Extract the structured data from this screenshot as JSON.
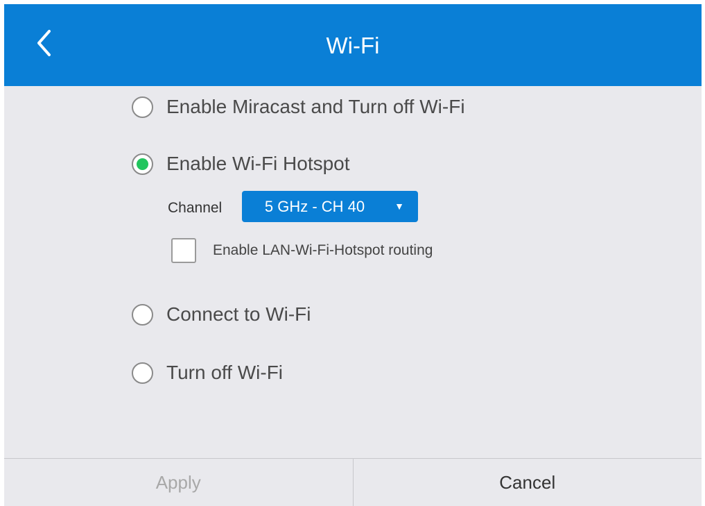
{
  "header": {
    "title": "Wi-Fi",
    "back_icon": "chevron-left-icon"
  },
  "options": [
    {
      "label": "Enable Miracast and Turn off Wi-Fi",
      "selected": false
    },
    {
      "label": "Enable Wi-Fi Hotspot",
      "selected": true
    },
    {
      "label": "Connect to Wi-Fi",
      "selected": false
    },
    {
      "label": "Turn off Wi-Fi",
      "selected": false
    }
  ],
  "hotspot": {
    "channel_label": "Channel",
    "channel_value": "5 GHz - CH 40",
    "dropdown_icon": "caret-down-icon",
    "routing_label": "Enable LAN-Wi-Fi-Hotspot routing",
    "routing_checked": false
  },
  "footer": {
    "apply_label": "Apply",
    "cancel_label": "Cancel"
  },
  "colors": {
    "accent": "#0a7fd6",
    "selected_radio": "#22c55e",
    "background": "#e9e9ed",
    "disabled_text": "#a8a8a8"
  }
}
